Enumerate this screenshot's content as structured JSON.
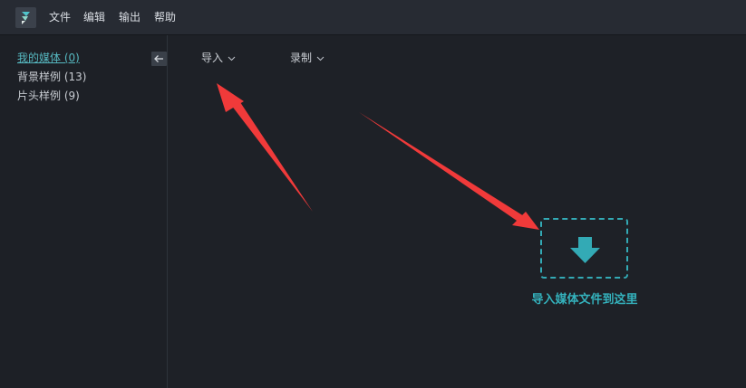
{
  "menubar": {
    "logo_icon": "filmora-logo-icon",
    "items": [
      {
        "label": "文件"
      },
      {
        "label": "编辑"
      },
      {
        "label": "输出"
      },
      {
        "label": "帮助"
      }
    ]
  },
  "sidebar": {
    "items": [
      {
        "label": "我的媒体 (0)",
        "active": true
      },
      {
        "label": "背景样例 (13)",
        "active": false
      },
      {
        "label": "片头样例 (9)",
        "active": false
      }
    ],
    "collapse_icon": "arrow-left-icon"
  },
  "toolbar": {
    "import_label": "导入",
    "record_label": "录制"
  },
  "dropzone": {
    "icon": "download-arrow-icon",
    "label": "导入媒体文件到这里"
  },
  "colors": {
    "accent": "#34b2bd",
    "annotation": "#f03a3a",
    "background": "#1e2127",
    "menubar": "#272b33"
  }
}
